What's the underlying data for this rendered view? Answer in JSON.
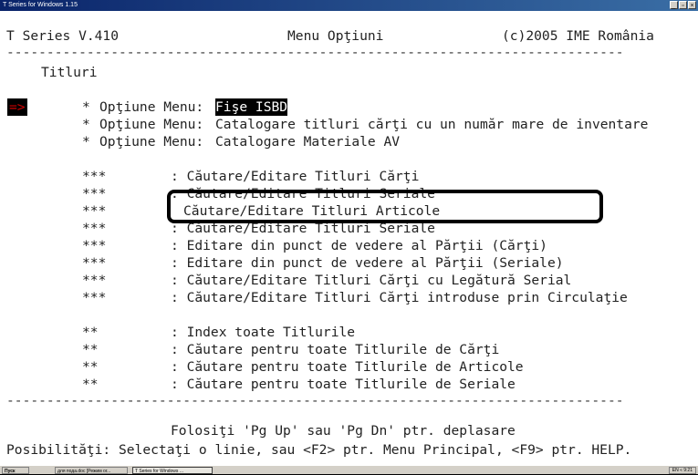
{
  "window": {
    "title": "T Series for Windows 1.15",
    "btn_min": "_",
    "btn_max": "▫",
    "btn_close": "×"
  },
  "console": {
    "header_left": "T Series V.410",
    "header_center": "Menu Opţiuni",
    "header_right": "(c)2005 IME România",
    "separator": "-----------------------------------------------------------------------------",
    "section_title": "Titluri",
    "cursor_arrow": "=>",
    "options": [
      {
        "bullet": "*",
        "prefix": "Opţiune Menu:",
        "value": "Fişe ISBD",
        "selected": true
      },
      {
        "bullet": "*",
        "prefix": "Opţiune Menu:",
        "value": "Catalogare titluri cărţi cu un număr mare de inventare",
        "selected": false
      },
      {
        "bullet": "*",
        "prefix": "Opţiune Menu:",
        "value": "Catalogare Materiale AV",
        "selected": false
      }
    ],
    "group3": [
      {
        "marker": "***",
        "text": ": Căutare/Editare Titluri Cărţi"
      },
      {
        "marker": "***",
        "text": ": Căutare/Editare Titluri Seriale"
      },
      {
        "marker": "***",
        "text": "Căutare/Editare Titluri Articole"
      },
      {
        "marker": "***",
        "text": ": Căutare/Editare Titluri Seriale"
      },
      {
        "marker": "***",
        "text": ": Editare din punct de vedere al Părţii (Cărţi)"
      },
      {
        "marker": "***",
        "text": ": Editare din punct de vedere al Părţii (Seriale)"
      },
      {
        "marker": "***",
        "text": ": Căutare/Editare Titluri Cărţi cu Legătură Serial"
      },
      {
        "marker": "***",
        "text": ": Căutare/Editare Titluri Cărţi introduse prin Circulaţie"
      }
    ],
    "group2": [
      {
        "marker": "**",
        "text": ": Index toate Titlurile"
      },
      {
        "marker": "**",
        "text": ": Căutare pentru toate Titlurile de Cărţi"
      },
      {
        "marker": "**",
        "text": ": Căutare pentru toate Titlurile de Articole"
      },
      {
        "marker": "**",
        "text": ": Căutare pentru toate Titlurile de Seriale"
      }
    ],
    "footer_hint": "Folosiţi 'Pg Up' sau 'Pg Dn' ptr. deplasare",
    "footer_status": "Posibilităţi: Selectaţi o linie, sau <F2> ptr. Menu Principal, <F9> ptr. HELP."
  },
  "taskbar": {
    "start": "Пуск",
    "item1": "для пода.doc [Режим ог...",
    "item2": "T Series for Windows ...",
    "tray": "EN « 9:21"
  },
  "colors": {
    "title_bar": "#0a246a",
    "arrow": "#d00000",
    "highlight_bg": "#000000"
  }
}
